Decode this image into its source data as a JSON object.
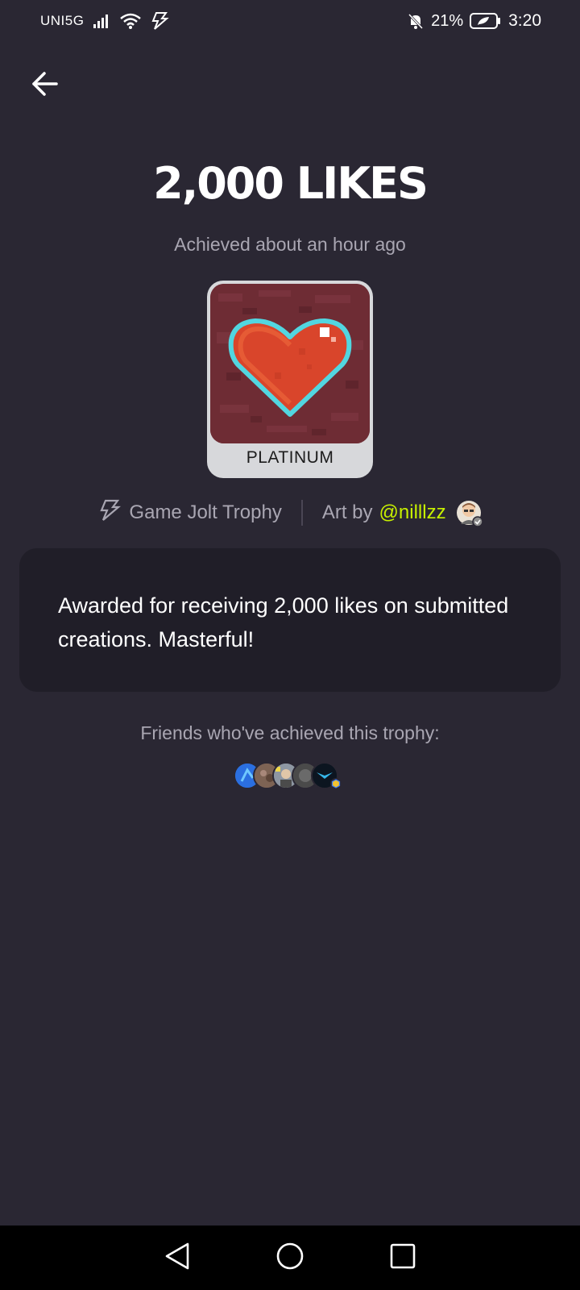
{
  "status_bar": {
    "carrier": "UNI5G",
    "battery_percent": "21%",
    "time": "3:20",
    "icons": [
      "signal-icon",
      "wifi-icon",
      "bolt-icon",
      "bell-off-icon",
      "battery-icon"
    ]
  },
  "header": {
    "back_icon": "back-arrow-icon"
  },
  "trophy": {
    "title": "2,000 LIKES",
    "achieved": "Achieved about an hour ago",
    "level": "PLATINUM",
    "image_icon": "pixel-heart-trophy"
  },
  "meta": {
    "source_icon": "game-jolt-bolt-icon",
    "source": "Game Jolt Trophy",
    "art_by_label": "Art by",
    "artist": "@nilllzz",
    "artist_avatar_icon": "artist-avatar"
  },
  "description": "Awarded for receiving 2,000 likes on submitted creations. Masterful!",
  "friends": {
    "label": "Friends who've achieved this trophy:",
    "avatars": [
      "friend-avatar-1",
      "friend-avatar-2",
      "friend-avatar-3",
      "friend-avatar-4",
      "friend-avatar-5"
    ]
  },
  "nav": {
    "back": "nav-back-icon",
    "home": "nav-home-icon",
    "recents": "nav-recents-icon"
  },
  "colors": {
    "background": "#2a2733",
    "card": "#201e28",
    "accent_link": "#c7f000",
    "muted_text": "#a9a6b2",
    "trophy_badge": "#d7d8db"
  }
}
